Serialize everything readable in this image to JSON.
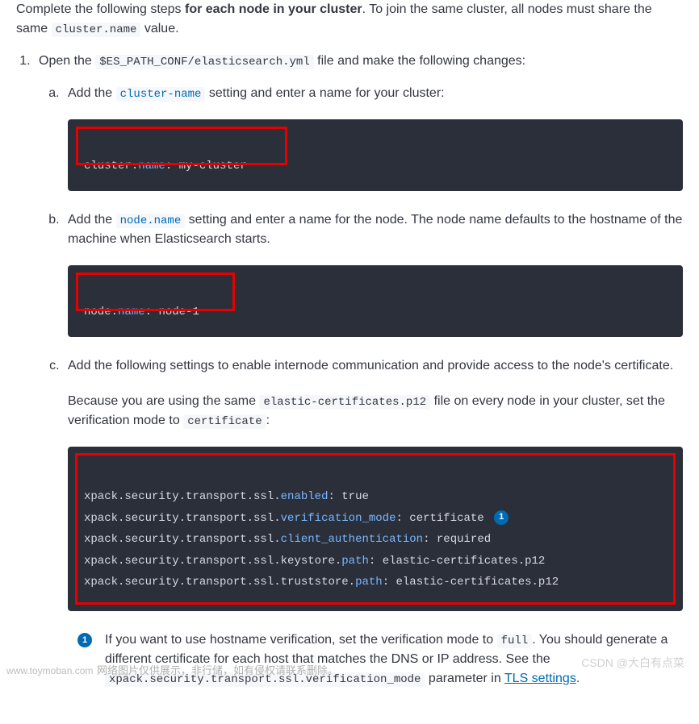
{
  "intro": {
    "prefix": "Complete the following steps ",
    "bold": "for each node in your cluster",
    "mid": ". To join the same cluster, all nodes must share the same ",
    "code": "cluster.name",
    "suffix": " value."
  },
  "step1": {
    "prefix": "Open the ",
    "code": "$ES_PATH_CONF/elasticsearch.yml",
    "suffix": " file and make the following changes:"
  },
  "sub_a": {
    "prefix": "Add the ",
    "code": "cluster-name",
    "suffix": " setting and enter a name for your cluster:"
  },
  "code_a": {
    "k1": "cluster",
    "k2": "name",
    "v": "my-cluster"
  },
  "sub_b": {
    "prefix": "Add the ",
    "code": "node.name",
    "suffix": " setting and enter a name for the node. The node name defaults to the hostname of the machine when Elasticsearch starts."
  },
  "code_b": {
    "k1": "node",
    "k2": "name",
    "v": "node-1"
  },
  "sub_c": {
    "p1": "Add the following settings to enable internode communication and provide access to the node's certificate.",
    "p2_prefix": "Because you are using the same ",
    "p2_code1": "elastic-certificates.p12",
    "p2_mid": " file on every node in your cluster, set the verification mode to ",
    "p2_code2": "certificate",
    "p2_suffix": ":"
  },
  "code_c": {
    "l1_prefix": "xpack.security.transport.ssl",
    "l1_prop": "enabled",
    "l1_val": "true",
    "l2_prop": "verification_mode",
    "l2_val": "certificate",
    "l3_prop": "client_authentication",
    "l3_val": "required",
    "l4_mid": "keystore",
    "l4_prop": "path",
    "l4_val": "elastic-certificates.p12",
    "l5_mid": "truststore",
    "l5_prop": "path",
    "l5_val": "elastic-certificates.p12",
    "badge": "1"
  },
  "callout": {
    "num": "1",
    "prefix": "If you want to use hostname verification, set the verification mode to ",
    "code1": "full",
    "mid": ". You should generate a different certificate for each host that matches the DNS or IP address. See the ",
    "code2": "xpack.security.transport.ssl.verification_mode",
    "mid2": " parameter in ",
    "link": "TLS settings",
    "suffix": "."
  },
  "watermarks": {
    "left": "www.toymoban.com",
    "center": "网络图片仅供展示，非行储，如有侵权请联系删除。",
    "right": "CSDN @大白有点菜"
  }
}
